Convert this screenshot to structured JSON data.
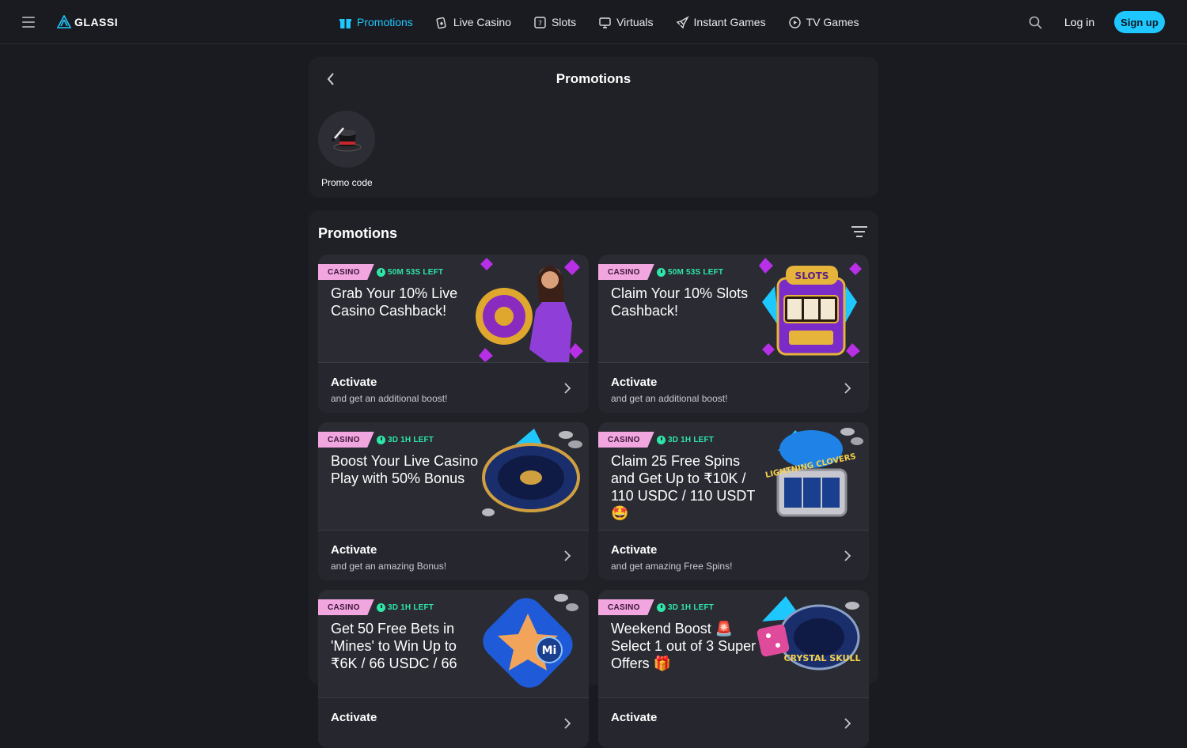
{
  "header": {
    "logo_text": "GLASSI",
    "nav": [
      {
        "label": "Promotions",
        "icon": "gift-icon",
        "active": true
      },
      {
        "label": "Live Casino",
        "icon": "cards-icon"
      },
      {
        "label": "Slots",
        "icon": "slot-icon"
      },
      {
        "label": "Virtuals",
        "icon": "virtuals-icon"
      },
      {
        "label": "Instant Games",
        "icon": "rocket-icon"
      },
      {
        "label": "TV Games",
        "icon": "tv-icon"
      }
    ],
    "login_label": "Log in",
    "signup_label": "Sign up",
    "accent_color": "#1ec8ff"
  },
  "top_panel": {
    "title": "Promotions",
    "promo_code_label": "Promo code"
  },
  "list_panel": {
    "title": "Promotions",
    "cards": [
      {
        "tag": "CASINO",
        "timer": "50M 53S LEFT",
        "title": "Grab Your 10% Live Casino Cashback!",
        "action": "Activate",
        "sub": "and get an additional boost!"
      },
      {
        "tag": "CASINO",
        "timer": "50M 53S LEFT",
        "title": "Claim Your 10% Slots Cashback!",
        "action": "Activate",
        "sub": "and get an additional boost!"
      },
      {
        "tag": "CASINO",
        "timer": "3D 1H LEFT",
        "title": "Boost Your Live Casino Play with 50% Bonus",
        "action": "Activate",
        "sub": "and get an amazing Bonus!"
      },
      {
        "tag": "CASINO",
        "timer": "3D 1H LEFT",
        "title": "Claim 25 Free Spins and Get Up to ₹10K / 110 USDC / 110 USDT 🤩",
        "action": "Activate",
        "sub": "and get amazing Free Spins!"
      },
      {
        "tag": "CASINO",
        "timer": "3D 1H LEFT",
        "title": "Get 50 Free Bets in 'Mines' to Win Up to ₹6K / 66 USDC / 66",
        "action": "Activate",
        "sub": ""
      },
      {
        "tag": "CASINO",
        "timer": "3D 1H LEFT",
        "title": "Weekend Boost 🚨 Select 1 out of 3 Super Offers 🎁",
        "action": "Activate",
        "sub": ""
      }
    ],
    "art_texts": {
      "slots": "SLOTS",
      "lightning": "LIGHTNING CLOVERS",
      "mines": "Mi",
      "crystal": "CRYSTAL SKULL"
    }
  }
}
